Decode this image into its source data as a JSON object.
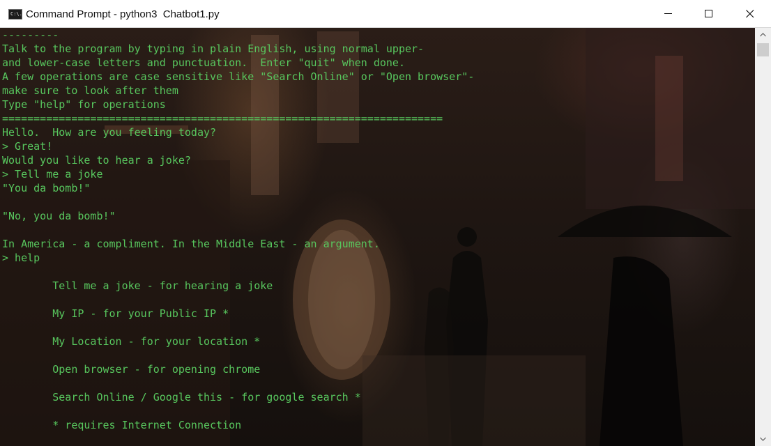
{
  "window": {
    "title": "Command Prompt - python3  Chatbot1.py",
    "app_icon_text": "C:\\."
  },
  "console": {
    "text_color": "#58c75e",
    "lines": [
      "---------",
      "Talk to the program by typing in plain English, using normal upper-",
      "and lower-case letters and punctuation.  Enter \"quit\" when done.",
      "A few operations are case sensitive like \"Search Online\" or \"Open browser\"-",
      "make sure to look after them",
      "Type \"help\" for operations",
      "======================================================================",
      "Hello.  How are you feeling today?",
      "> Great!",
      "Would you like to hear a joke?",
      "> Tell me a joke",
      "\"You da bomb!\"",
      "",
      "\"No, you da bomb!\"",
      "",
      "In America - a compliment. In the Middle East - an argument.",
      "> help",
      "",
      "        Tell me a joke - for hearing a joke",
      "",
      "        My IP - for your Public IP *",
      "",
      "        My Location - for your location *",
      "",
      "        Open browser - for opening chrome",
      "",
      "        Search Online / Google this - for google search *",
      "",
      "        * requires Internet Connection",
      "",
      ">"
    ]
  },
  "icons": {
    "minimize": "minimize-icon",
    "maximize": "maximize-icon",
    "close": "close-icon",
    "scroll_up": "chevron-up-icon",
    "scroll_down": "chevron-down-icon"
  }
}
